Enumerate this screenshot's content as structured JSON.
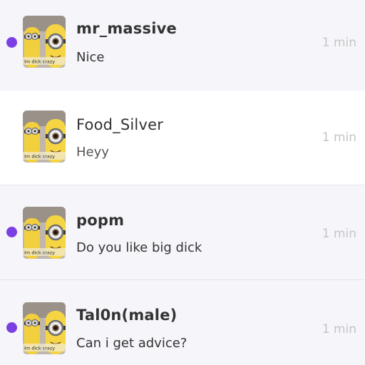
{
  "conversations": [
    {
      "name": "mr_massive",
      "message": "Nice",
      "time": "1 min",
      "unread": true
    },
    {
      "name": "Food_Silver",
      "message": "Heyy",
      "time": "1 min",
      "unread": false
    },
    {
      "name": "popm",
      "message": "Do you like big dick",
      "time": "1 min",
      "unread": true
    },
    {
      "name": "Tal0n(male)",
      "message": "Can i get advice?",
      "time": "1 min",
      "unread": true
    }
  ],
  "avatar": {
    "icon": "minion-avatar-icon",
    "caption": "Im dick crazy"
  },
  "colors": {
    "unread_dot": "#7b3fe4",
    "unread_bg": "#f6f5fa",
    "read_bg": "#ffffff",
    "time": "#c5c5c5"
  }
}
